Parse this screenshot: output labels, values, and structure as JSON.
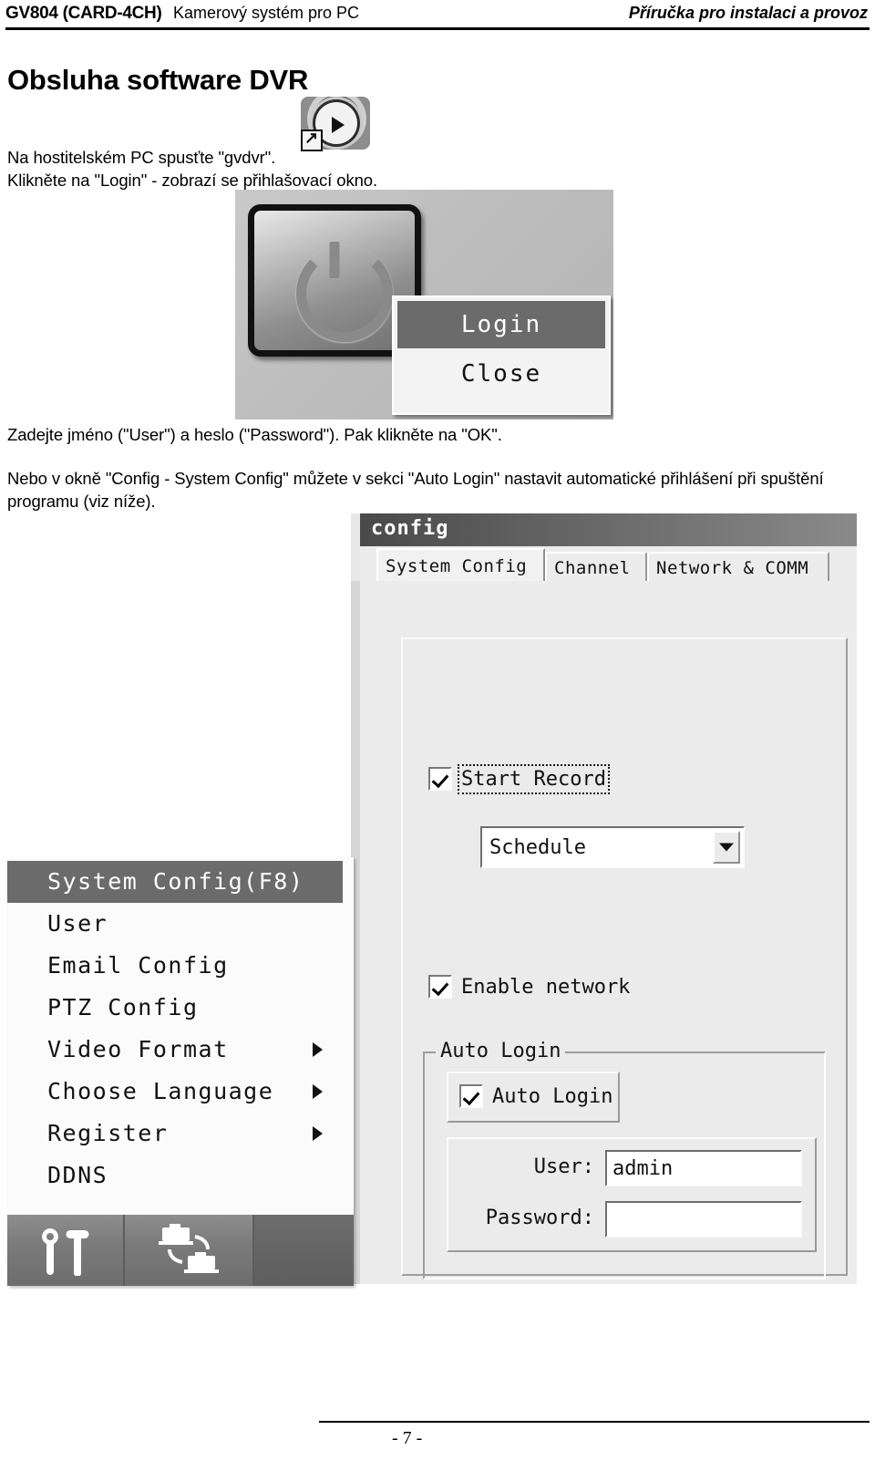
{
  "header": {
    "model": "GV804 (CARD-4CH)",
    "subtitle": "Kamerový systém pro PC",
    "right_title": "Příručka pro instalaci a provoz"
  },
  "doc": {
    "title": "Obsluha software DVR",
    "para1_line1": "Na hostitelském PC spusťte \"gvdvr\"",
    "para1_line1_end": ".",
    "para1_line2": "Klikněte na \"Login\" - zobrazí se přihlašovací okno.",
    "para2": "Zadejte jméno (\"User\") a heslo (\"Password\"). Pak klikněte na \"OK\".",
    "para3": "Nebo v okně \"Config - System Config\" můžete v sekci \"Auto Login\" nastavit automatické přihlášení při spuštění programu (viz níže)."
  },
  "login_shot": {
    "power_button_name": "power-button",
    "menu": [
      {
        "label": "Login",
        "selected": true
      },
      {
        "label": "Close",
        "selected": false
      }
    ]
  },
  "config_shot": {
    "window_title": "config",
    "tabs": [
      {
        "label": "System Config",
        "active": true
      },
      {
        "label": "Channel",
        "active": false
      },
      {
        "label": "Network & COMM",
        "active": false
      }
    ],
    "start_record": {
      "label": "Start Record",
      "checked": true
    },
    "schedule_combo": {
      "value": "Schedule"
    },
    "enable_network": {
      "label": "Enable network",
      "checked": true
    },
    "auto_login_group": {
      "title": "Auto Login",
      "checkbox_label": "Auto Login",
      "checkbox_checked": true,
      "user_label": "User:",
      "user_value": "admin",
      "password_label": "Password:",
      "password_value": ""
    }
  },
  "menu_shot": {
    "items": [
      {
        "label": "System Config(F8)",
        "selected": true,
        "submenu": false
      },
      {
        "label": "User",
        "selected": false,
        "submenu": false
      },
      {
        "label": "Email Config",
        "selected": false,
        "submenu": false
      },
      {
        "label": "PTZ Config",
        "selected": false,
        "submenu": false
      },
      {
        "label": "Video Format",
        "selected": false,
        "submenu": true
      },
      {
        "label": "Choose Language",
        "selected": false,
        "submenu": true
      },
      {
        "label": "Register",
        "selected": false,
        "submenu": true
      },
      {
        "label": "DDNS",
        "selected": false,
        "submenu": false
      }
    ],
    "toolbar": [
      {
        "icon": "tools-icon"
      },
      {
        "icon": "ptz-camera-icon"
      },
      {
        "icon": "blank-icon"
      }
    ]
  },
  "footer": {
    "page_number": "- 7 -"
  },
  "colors": {
    "menu_highlight": "#6b6b6b",
    "dialog_face": "#ececec",
    "titlebar_dark": "#4a4a4a"
  }
}
